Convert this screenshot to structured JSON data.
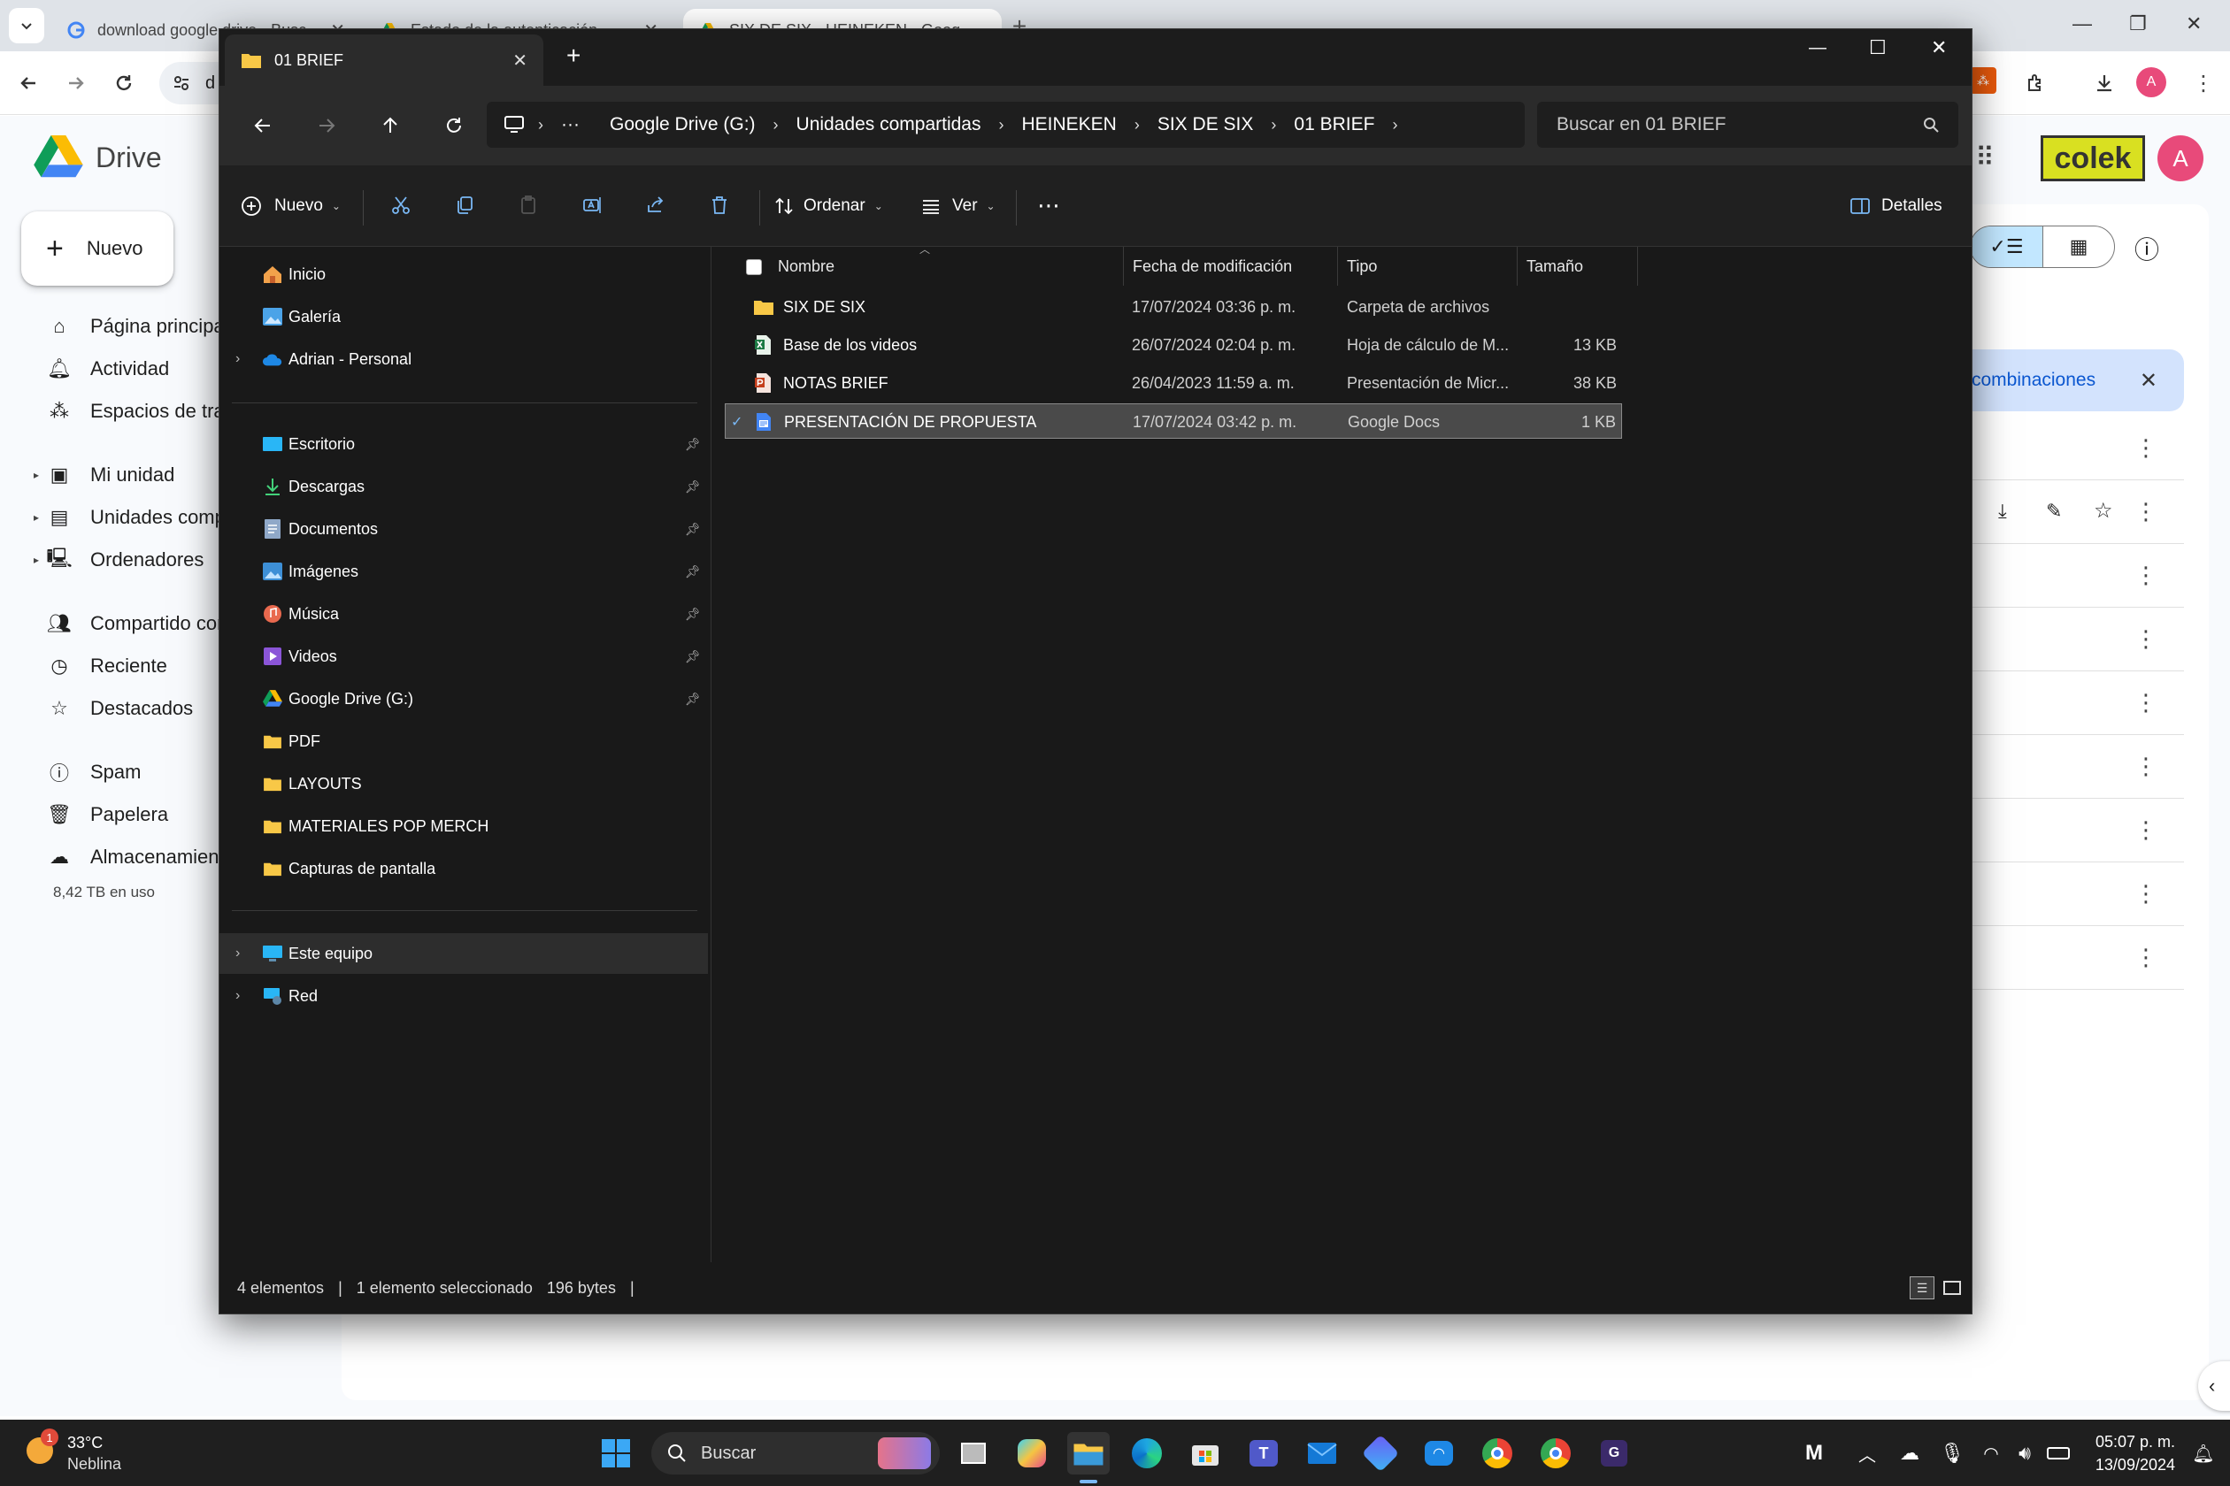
{
  "chrome": {
    "tabs": [
      {
        "title": "download google drive - Busc"
      },
      {
        "title": "Estado de la autenticación"
      },
      {
        "title": "SIX DE SIX - HEINEKEN - Goog"
      }
    ],
    "address_partial": "d"
  },
  "drive": {
    "brand": "Drive",
    "new_label": "Nuevo",
    "nav": [
      "Página principal",
      "Actividad",
      "Espacios de trabajo",
      "Mi unidad",
      "Unidades compartidas",
      "Ordenadores",
      "Compartido conmigo",
      "Reciente",
      "Destacados",
      "Spam",
      "Papelera",
      "Almacenamiento"
    ],
    "storage_used": "8,42 TB en uso",
    "banner_text": "combinaciones",
    "logo_text": "colek",
    "avatar_letter": "A"
  },
  "explorer": {
    "tab_title": "01 BRIEF",
    "breadcrumb": [
      "Google Drive (G:)",
      "Unidades compartidas",
      "HEINEKEN",
      "SIX DE SIX",
      "01 BRIEF"
    ],
    "search_placeholder": "Buscar en 01 BRIEF",
    "cmd": {
      "new": "Nuevo",
      "sort": "Ordenar",
      "view": "Ver",
      "details": "Detalles"
    },
    "sidebar": {
      "top": [
        "Inicio",
        "Galería",
        "Adrian - Personal"
      ],
      "pinned": [
        "Escritorio",
        "Descargas",
        "Documentos",
        "Imágenes",
        "Música",
        "Videos",
        "Google Drive (G:)"
      ],
      "folders": [
        "PDF",
        "LAYOUTS",
        "MATERIALES POP MERCH",
        "Capturas de pantalla"
      ],
      "bottom": [
        "Este equipo",
        "Red"
      ]
    },
    "columns": [
      "Nombre",
      "Fecha de modificación",
      "Tipo",
      "Tamaño"
    ],
    "files": [
      {
        "name": "SIX DE SIX",
        "date": "17/07/2024 03:36 p. m.",
        "type": "Carpeta de archivos",
        "size": "",
        "icon": "folder-icon"
      },
      {
        "name": "Base de los videos",
        "date": "26/07/2024 02:04 p. m.",
        "type": "Hoja de cálculo de M...",
        "size": "13 KB",
        "icon": "excel-icon"
      },
      {
        "name": "NOTAS BRIEF",
        "date": "26/04/2023 11:59 a. m.",
        "type": "Presentación de Micr...",
        "size": "38 KB",
        "icon": "powerpoint-icon"
      },
      {
        "name": "PRESENTACIÓN DE PROPUESTA",
        "date": "17/07/2024 03:42 p. m.",
        "type": "Google Docs",
        "size": "1 KB",
        "icon": "google-docs-icon",
        "selected": true
      }
    ],
    "status": {
      "count": "4 elementos",
      "selection": "1 elemento seleccionado",
      "bytes": "196 bytes"
    }
  },
  "taskbar": {
    "weather_temp": "33°C",
    "weather_desc": "Neblina",
    "weather_badge": "1",
    "search_label": "Buscar",
    "time": "05:07 p. m.",
    "date": "13/09/2024"
  }
}
